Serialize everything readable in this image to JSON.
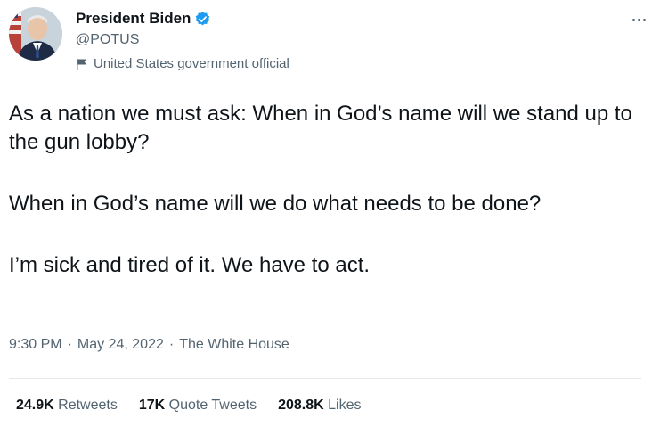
{
  "author": {
    "display_name": "President Biden",
    "handle": "@POTUS",
    "label": "United States government official",
    "verified": true,
    "avatar_icon": "avatar-portrait",
    "verified_color": "#1d9bf0"
  },
  "menu": {
    "more_icon": "more-horizontal-icon"
  },
  "tweet": {
    "paragraphs": [
      "As a nation we must ask: When in God’s name will we stand up to the gun lobby?",
      "When in God’s name will we do what needs to be done?",
      "I’m sick and tired of it. We have to act."
    ],
    "time": "9:30 PM",
    "date": "May 24, 2022",
    "source": "The White House",
    "separator": "·"
  },
  "stats": {
    "retweets_count": "24.9K",
    "retweets_label": "Retweets",
    "quotes_count": "17K",
    "quotes_label": "Quote Tweets",
    "likes_count": "208.8K",
    "likes_label": "Likes"
  },
  "colors": {
    "text_primary": "#0f1419",
    "text_secondary": "#536471",
    "divider": "#e5e9eb"
  }
}
